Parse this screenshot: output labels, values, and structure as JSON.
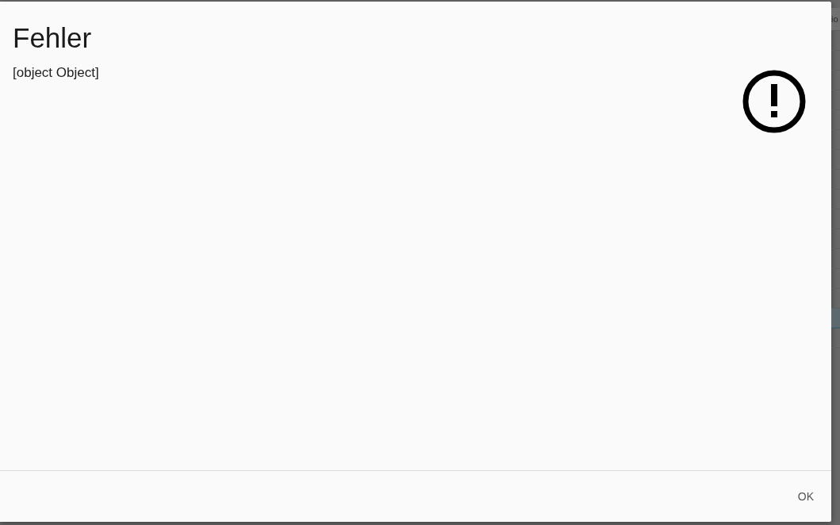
{
  "background": {
    "column_header": "io"
  },
  "dialog": {
    "title": "Fehler",
    "message": "[object Object]",
    "buttons": [
      "OK"
    ]
  }
}
